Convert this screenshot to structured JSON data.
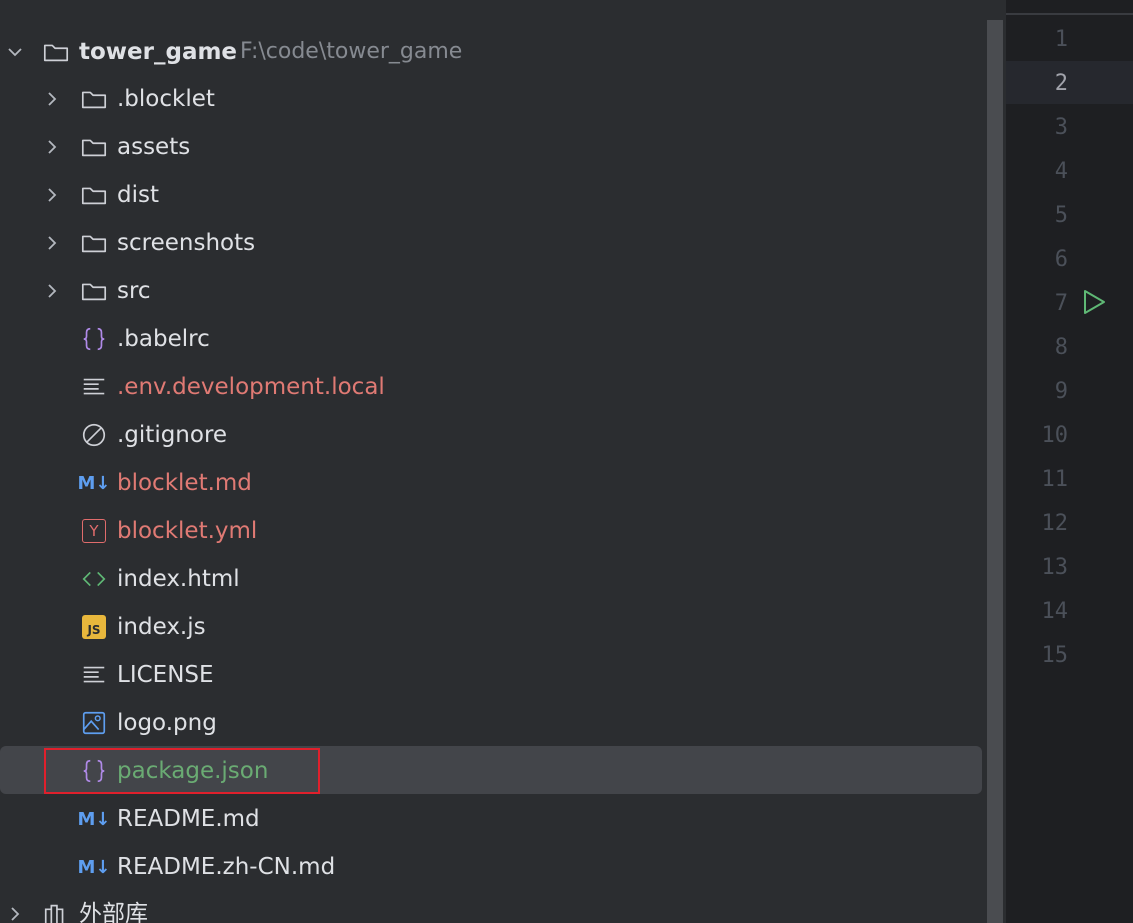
{
  "project": {
    "name": "tower_game",
    "path": "F:\\code\\tower_game"
  },
  "tree": {
    "folders": [
      {
        "label": ".blocklet"
      },
      {
        "label": "assets"
      },
      {
        "label": "dist"
      },
      {
        "label": "screenshots"
      },
      {
        "label": "src"
      }
    ],
    "files": [
      {
        "label": ".babelrc",
        "icon": "json-braces-icon"
      },
      {
        "label": ".env.development.local",
        "icon": "text-file-icon"
      },
      {
        "label": ".gitignore",
        "icon": "ignore-icon"
      },
      {
        "label": "blocklet.md",
        "icon": "markdown-icon"
      },
      {
        "label": "blocklet.yml",
        "icon": "yaml-icon"
      },
      {
        "label": "index.html",
        "icon": "html-icon"
      },
      {
        "label": "index.js",
        "icon": "javascript-icon"
      },
      {
        "label": "LICENSE",
        "icon": "text-file-icon"
      },
      {
        "label": "logo.png",
        "icon": "image-icon"
      },
      {
        "label": "package.json",
        "icon": "json-braces-icon"
      },
      {
        "label": "README.md",
        "icon": "markdown-icon"
      },
      {
        "label": "README.zh-CN.md",
        "icon": "markdown-icon"
      }
    ],
    "external_libraries": "外部库",
    "icon_text": {
      "markdown": "M↓",
      "yaml": "Y",
      "javascript": "JS"
    }
  },
  "gutter": {
    "line_numbers": [
      "1",
      "2",
      "3",
      "4",
      "5",
      "6",
      "7",
      "8",
      "9",
      "10",
      "11",
      "12",
      "13",
      "14",
      "15"
    ],
    "current_line": "2"
  },
  "colors": {
    "background": "#2b2d30",
    "selected_row": "#43454a",
    "modified_file": "#e07a74",
    "added_file": "#6aab73",
    "highlight_box": "#e0202c"
  }
}
